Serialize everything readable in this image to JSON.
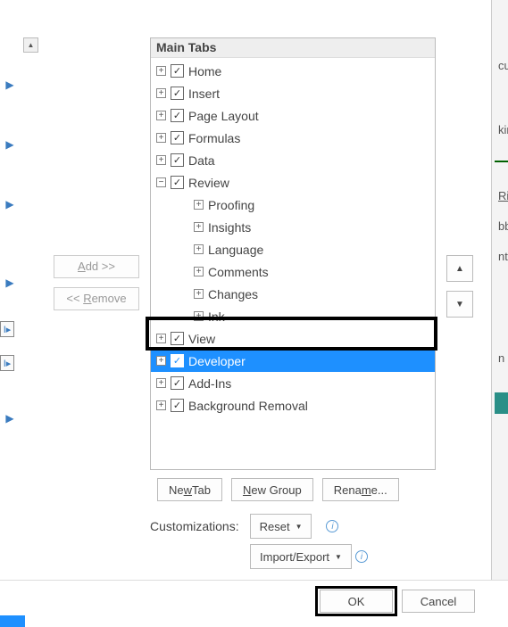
{
  "header": {
    "title": "Main Tabs"
  },
  "tree": {
    "items": [
      {
        "label": "Home",
        "checked": true,
        "expand": "+"
      },
      {
        "label": "Insert",
        "checked": true,
        "expand": "+"
      },
      {
        "label": "Page Layout",
        "checked": true,
        "expand": "+"
      },
      {
        "label": "Formulas",
        "checked": true,
        "expand": "+"
      },
      {
        "label": "Data",
        "checked": true,
        "expand": "+"
      },
      {
        "label": "Review",
        "checked": true,
        "expand": "−"
      },
      {
        "label": "View",
        "checked": true,
        "expand": "+"
      },
      {
        "label": "Developer",
        "checked": true,
        "expand": "+",
        "selected": true
      },
      {
        "label": "Add-Ins",
        "checked": true,
        "expand": "+"
      },
      {
        "label": "Background Removal",
        "checked": true,
        "expand": "+"
      }
    ],
    "review_children": [
      {
        "label": "Proofing",
        "expand": "+"
      },
      {
        "label": "Insights",
        "expand": "+"
      },
      {
        "label": "Language",
        "expand": "+"
      },
      {
        "label": "Comments",
        "expand": "+"
      },
      {
        "label": "Changes",
        "expand": "+"
      },
      {
        "label": "Ink",
        "expand": "+"
      }
    ]
  },
  "buttons": {
    "add": "Add >>",
    "add_ul": "A",
    "remove": "<< Remove",
    "remove_ul": "R",
    "newtab": "New Tab",
    "newtab_ul": "w",
    "newgroup": "New Group",
    "newgroup_ul": "N",
    "rename": "Rename...",
    "rename_ul": "m",
    "reset": "Reset",
    "reset_ul": "R",
    "importexport": "Import/Export",
    "ok": "OK",
    "cancel": "Cancel"
  },
  "labels": {
    "customizations": "Customizations:"
  },
  "rightFragments": {
    "a": "cu",
    "b": "kin",
    "c": "Ri",
    "d": "bb",
    "e": "nt",
    "f": "n"
  }
}
